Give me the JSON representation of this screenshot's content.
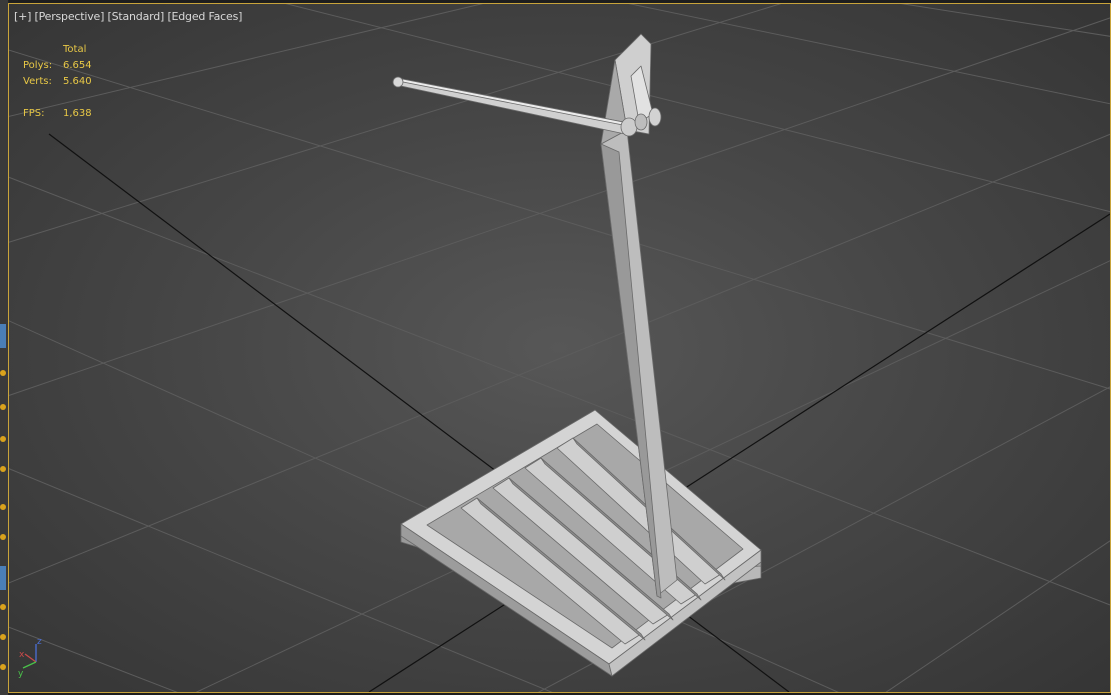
{
  "viewport": {
    "labels": [
      "[+]",
      "[Perspective]",
      "[Standard]",
      "[Edged Faces]"
    ]
  },
  "stats": {
    "total_header": "Total",
    "polys_label": "Polys:",
    "polys_value": "6.654",
    "verts_label": "Verts:",
    "verts_value": "5.640",
    "fps_label": "FPS:",
    "fps_value": "1,638"
  },
  "axis_gizmo": {
    "x": "x",
    "y": "y",
    "z": "z"
  },
  "colors": {
    "active_border": "#c9a43a",
    "stats_text": "#e8c846",
    "grid_line": "#5c5c5c",
    "model_light": "#d6d6d6",
    "model_mid": "#b4b4b4",
    "model_dark": "#8f8f8f"
  }
}
